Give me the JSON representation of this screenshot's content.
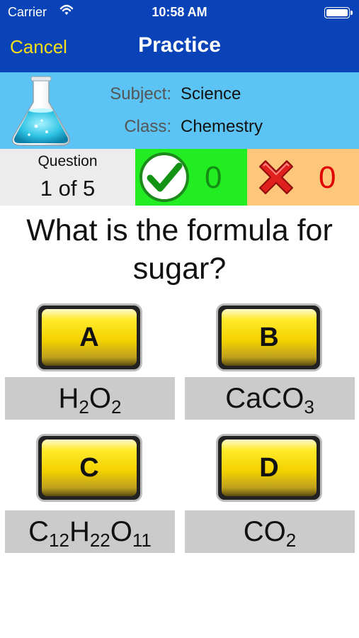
{
  "status_bar": {
    "carrier": "Carrier",
    "time": "10:58 AM"
  },
  "nav": {
    "cancel_label": "Cancel",
    "title": "Practice"
  },
  "info": {
    "subject_label": "Subject:",
    "subject_value": "Science",
    "class_label": "Class:",
    "class_value": "Chemestry"
  },
  "progress": {
    "question_label": "Question",
    "question_value": "1 of 5"
  },
  "score": {
    "correct_count": "0",
    "wrong_count": "0"
  },
  "question": {
    "text": "What is the formula for sugar?"
  },
  "answers": [
    {
      "letter": "A",
      "formula": [
        {
          "t": "H"
        },
        {
          "sub": "2"
        },
        {
          "t": "O"
        },
        {
          "sub": "2"
        }
      ]
    },
    {
      "letter": "B",
      "formula": [
        {
          "t": "CaCO"
        },
        {
          "sub": "3"
        }
      ]
    },
    {
      "letter": "C",
      "formula": [
        {
          "t": "C"
        },
        {
          "sub": "12"
        },
        {
          "t": "H"
        },
        {
          "sub": "22"
        },
        {
          "t": "O"
        },
        {
          "sub": "11"
        }
      ]
    },
    {
      "letter": "D",
      "formula": [
        {
          "t": "CO"
        },
        {
          "sub": "2"
        }
      ]
    }
  ],
  "colors": {
    "nav_bg": "#0a43b7",
    "cancel": "#f5df1a",
    "info_bg": "#5cc4f4",
    "correct_bg": "#22ec22",
    "wrong_bg": "#fcc77b",
    "answer_box": "#cbcbcb"
  },
  "icons": {
    "flask": "flask-icon",
    "correct": "checkmark-icon",
    "wrong": "x-icon"
  }
}
